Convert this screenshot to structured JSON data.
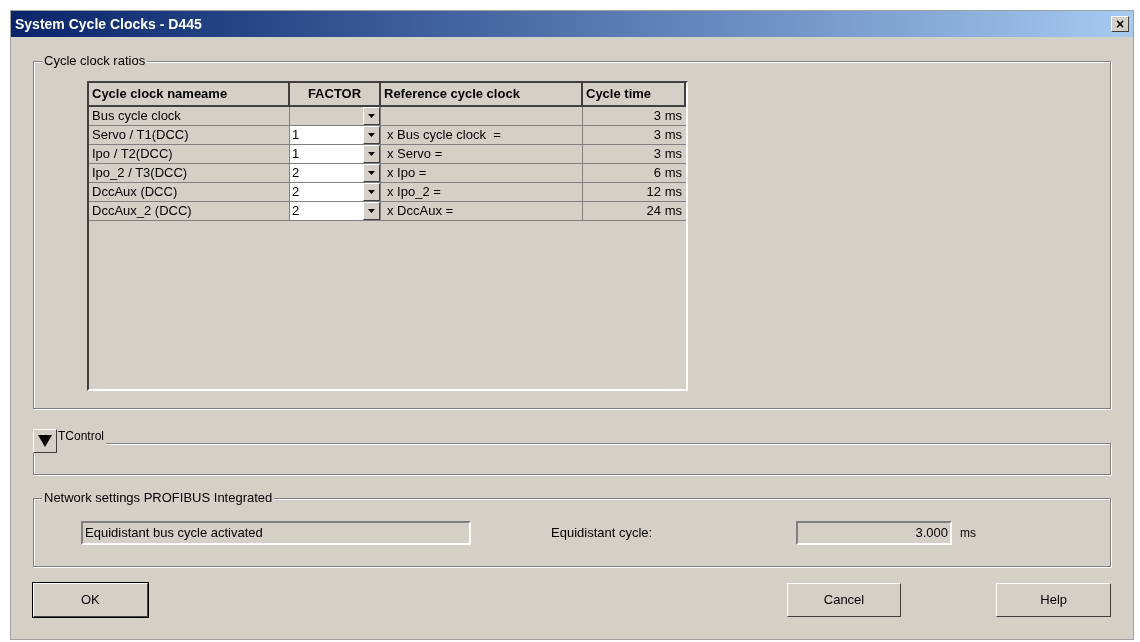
{
  "window": {
    "title": "System Cycle Clocks - D445",
    "close": "×"
  },
  "cycle_clock_ratios": {
    "title": "Cycle clock ratios",
    "table": {
      "columns": [
        "Cycle clock nameame",
        "FACTOR",
        "Reference cycle clock",
        "Cycle time"
      ],
      "rows": [
        {
          "name": "Bus cycle clock",
          "factor": {
            "disabled": true
          },
          "reference": "",
          "cycle_time": "3 ms"
        },
        {
          "name": "Servo / T1(DCC)",
          "factor": {
            "value": "1",
            "disabled": false
          },
          "reference": "x Bus cycle clock  =",
          "cycle_time": "3 ms"
        },
        {
          "name": "Ipo / T2(DCC)",
          "factor": {
            "value": "1",
            "disabled": false
          },
          "reference": "x Servo =",
          "cycle_time": "3 ms"
        },
        {
          "name": "Ipo_2 / T3(DCC)",
          "factor": {
            "value": "2",
            "disabled": false
          },
          "reference": "x Ipo =",
          "cycle_time": "6 ms"
        },
        {
          "name": "DccAux (DCC)",
          "factor": {
            "value": "2",
            "disabled": false
          },
          "reference": "x Ipo_2 =",
          "cycle_time": "12 ms"
        },
        {
          "name": "DccAux_2 (DCC)",
          "factor": {
            "value": "2",
            "disabled": false
          },
          "reference": "x DccAux =",
          "cycle_time": "24 ms"
        }
      ]
    }
  },
  "tcontrol": {
    "title": "TControl",
    "expanded": false
  },
  "network_settings": {
    "title": "Network settings PROFIBUS Integrated",
    "status_field": "Equidistant bus cycle activated",
    "cycle_label": "Equidistant cycle:",
    "cycle_value": "3.000",
    "cycle_unit": "ms"
  },
  "buttons": {
    "ok": "OK",
    "cancel": "Cancel",
    "help": "Help"
  }
}
